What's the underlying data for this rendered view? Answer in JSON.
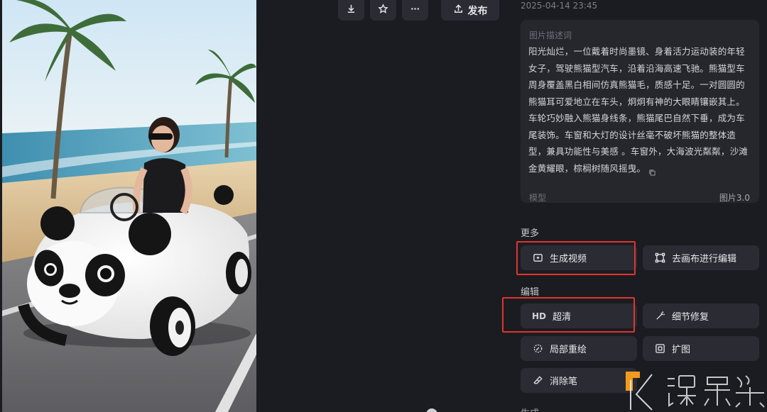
{
  "toolbar": {
    "download_icon": "download-icon",
    "favorite_icon": "star-icon",
    "more_icon": "more-icon",
    "publish_icon": "upload-icon",
    "publish_label": "发布"
  },
  "meta": {
    "timestamp": "2025-04-14 23:45"
  },
  "description": {
    "title": "图片描述词",
    "text": "阳光灿烂，一位戴着时尚墨镜、身着活力运动装的年轻女子，驾驶熊猫型汽车，沿着沿海高速飞驰。熊猫型车周身覆盖黑白相间仿真熊猫毛，质感十足。一对圆圆的熊猫耳可爱地立在车头，炯炯有神的大眼睛镶嵌其上。车轮巧妙融入熊猫身线条，熊猫尾巴自然下垂，成为车尾装饰。车窗和大灯的设计丝毫不破坏熊猫的整体造型，兼具功能性与美感 。车窗外，大海波光粼粼，沙滩金黄耀眼，棕榈树随风摇曳。",
    "model_label": "模型",
    "model_value": "图片3.0"
  },
  "sections": {
    "more_label": "更多",
    "edit_label": "编辑",
    "bottom_label": "生成"
  },
  "actions": {
    "generate_video": "生成视频",
    "canvas_edit": "去画布进行编辑",
    "hd_badge": "HD",
    "upscale": "超清",
    "detail_repair": "细节修复",
    "inpaint": "局部重绘",
    "outpaint": "扩图",
    "eraser": "消除笔"
  },
  "colors": {
    "background": "#1b1c21",
    "card": "#26272d",
    "button": "#2b2c33",
    "highlight_box": "#e0342d",
    "watermark_accent": "#f39a1e"
  }
}
